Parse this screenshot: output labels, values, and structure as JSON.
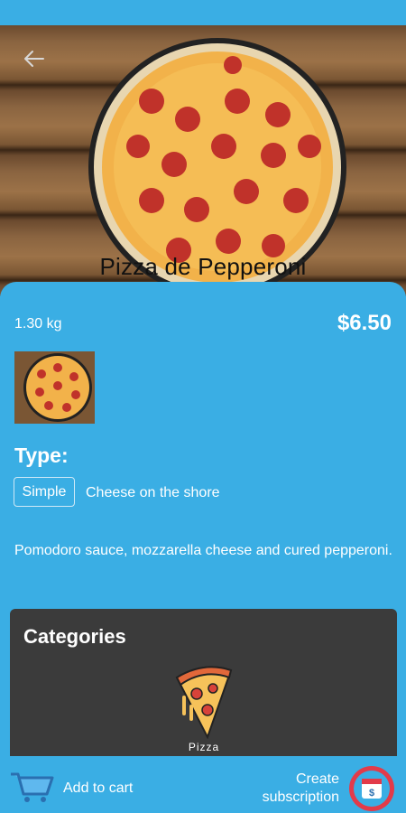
{
  "header": {
    "back_icon": "arrow-left-icon",
    "title": "Pizza de Pepperoni"
  },
  "product": {
    "weight": "1.30 kg",
    "price": "$6.50",
    "type_heading": "Type:",
    "type_option": "Simple",
    "type_description": "Cheese on the shore",
    "description": "Pomodoro sauce, mozzarella cheese and cured pepperoni."
  },
  "categories": {
    "heading": "Categories",
    "items": [
      {
        "label": "Pizza",
        "icon": "pizza-slice-icon"
      }
    ]
  },
  "actions": {
    "add_to_cart": "Add to cart",
    "subscription_line1": "Create",
    "subscription_line2": "subscription",
    "cart_icon": "cart-icon",
    "subscription_icon": "calendar-dollar-icon"
  },
  "colors": {
    "primary": "#3aaee4",
    "panel": "#3b3b3b",
    "text": "#ffffff"
  }
}
